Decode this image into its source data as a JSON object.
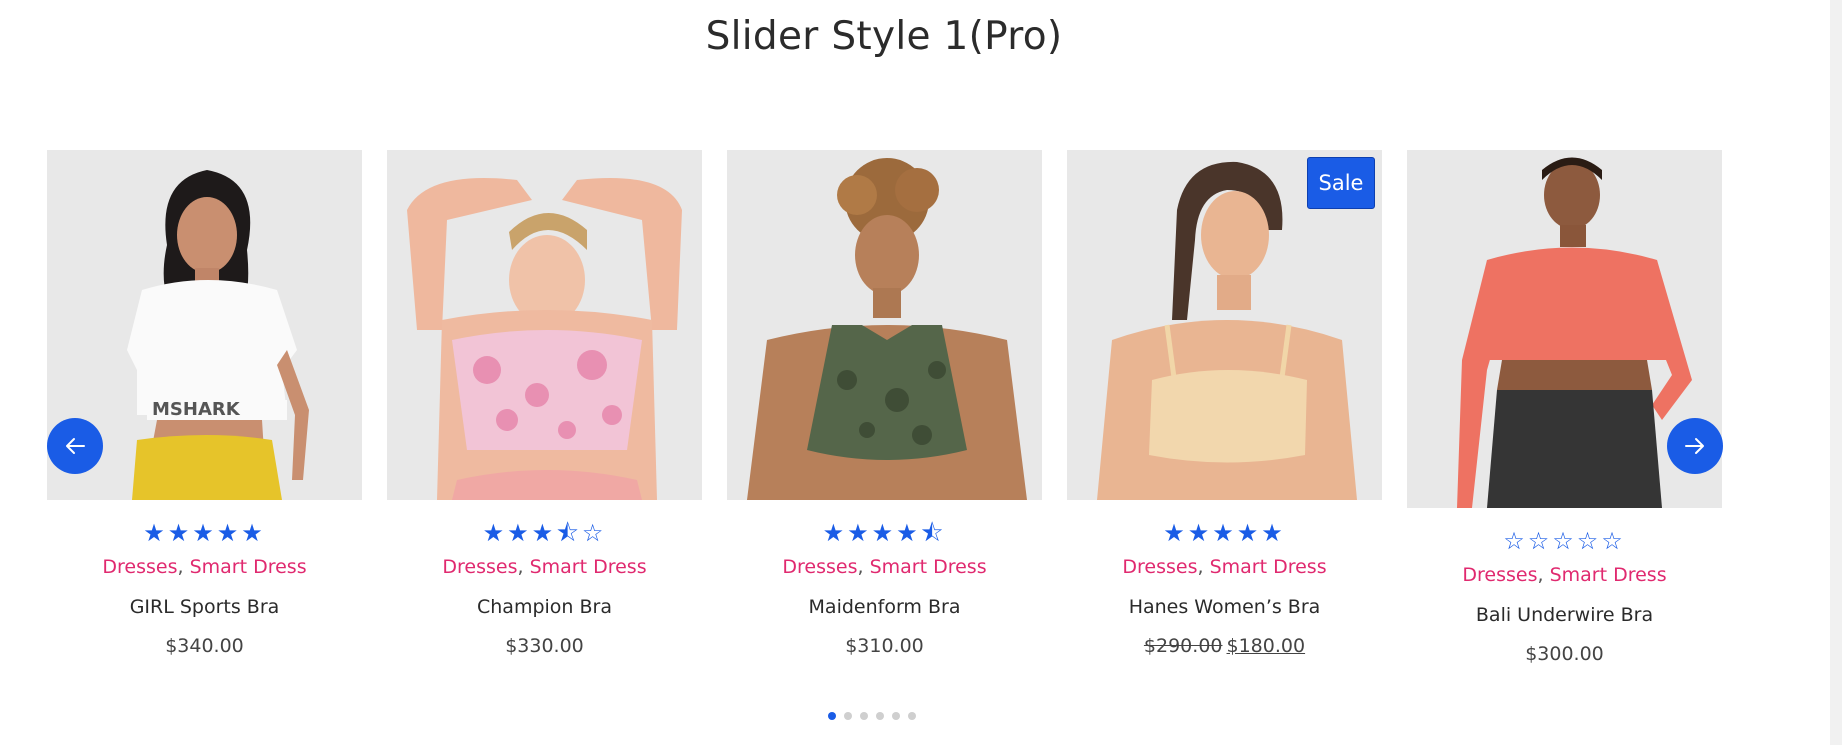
{
  "page": {
    "title": "Slider Style 1(Pro)"
  },
  "colors": {
    "accent": "#1a5ce6",
    "category": "#e0296f",
    "image_bg": "#e8e8e8"
  },
  "products": [
    {
      "name": "GIRL Sports Bra",
      "rating": 5,
      "stars": "★★★★★",
      "categories": [
        "Dresses",
        "Smart Dress"
      ],
      "separator": ", ",
      "price": "$340.00"
    },
    {
      "name": "Champion Bra",
      "rating": 3.5,
      "stars": "★★★⯪☆",
      "categories": [
        "Dresses",
        "Smart Dress"
      ],
      "separator": ", ",
      "price": "$330.00"
    },
    {
      "name": "Maidenform Bra",
      "rating": 4.5,
      "stars": "★★★★⯪",
      "categories": [
        "Dresses",
        "Smart Dress"
      ],
      "separator": ", ",
      "price": "$310.00"
    },
    {
      "name": "Hanes Women’s Bra",
      "rating": 5,
      "stars": "★★★★★",
      "categories": [
        "Dresses",
        "Smart Dress"
      ],
      "separator": ", ",
      "badge": "Sale",
      "old_price": "$290.00",
      "price": "$180.00"
    },
    {
      "name": "Bali Underwire Bra",
      "rating": 0,
      "stars": "☆☆☆☆☆",
      "categories": [
        "Dresses",
        "Smart Dress"
      ],
      "separator": ", ",
      "price": "$300.00"
    }
  ],
  "navigation": {
    "prev_icon": "arrow-left-icon",
    "next_icon": "arrow-right-icon"
  },
  "pagination": {
    "pages": 6,
    "current": 1
  }
}
